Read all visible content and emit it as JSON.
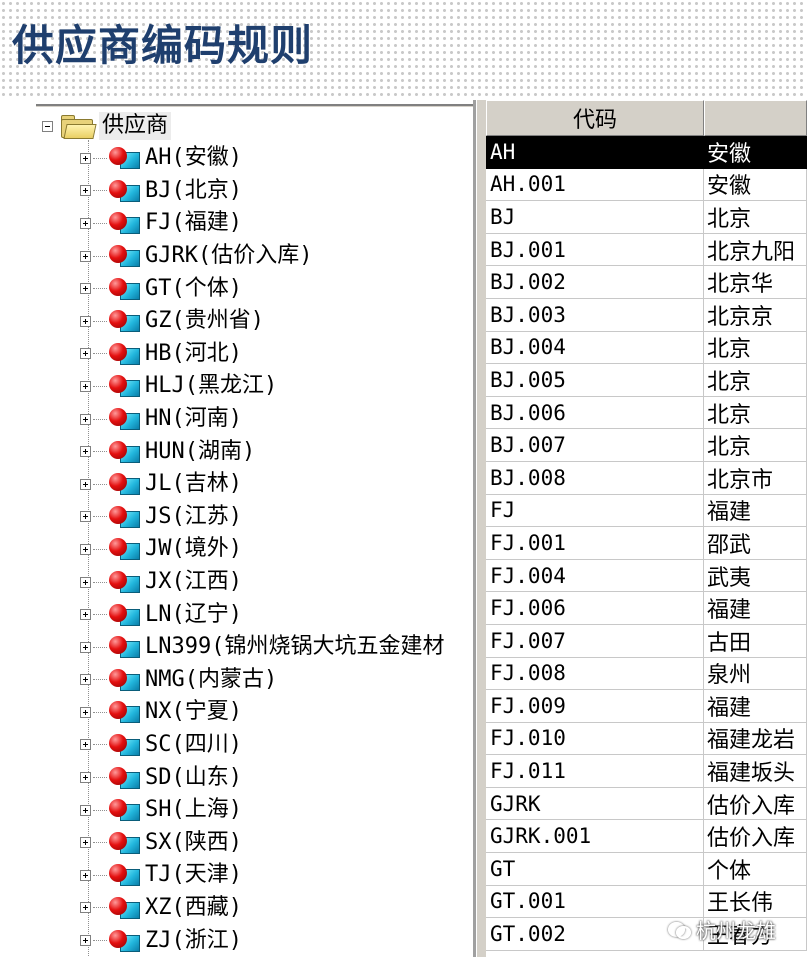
{
  "banner": {
    "title": "供应商编码规则"
  },
  "tree": {
    "root_label": "供应商",
    "items": [
      {
        "label": "AH(安徽)"
      },
      {
        "label": "BJ(北京)"
      },
      {
        "label": "FJ(福建)"
      },
      {
        "label": "GJRK(估价入库)"
      },
      {
        "label": "GT(个体)"
      },
      {
        "label": "GZ(贵州省)"
      },
      {
        "label": "HB(河北)"
      },
      {
        "label": "HLJ(黑龙江)"
      },
      {
        "label": "HN(河南)"
      },
      {
        "label": "HUN(湖南)"
      },
      {
        "label": "JL(吉林)"
      },
      {
        "label": "JS(江苏)"
      },
      {
        "label": "JW(境外)"
      },
      {
        "label": "JX(江西)"
      },
      {
        "label": "LN(辽宁)"
      },
      {
        "label": "LN399(锦州烧锅大坑五金建材"
      },
      {
        "label": "NMG(内蒙古)"
      },
      {
        "label": "NX(宁夏)"
      },
      {
        "label": "SC(四川)"
      },
      {
        "label": "SD(山东)"
      },
      {
        "label": "SH(上海)"
      },
      {
        "label": "SX(陕西)"
      },
      {
        "label": "TJ(天津)"
      },
      {
        "label": "XZ(西藏)"
      },
      {
        "label": "ZJ(浙江)"
      }
    ]
  },
  "grid": {
    "columns": [
      {
        "label": "代码"
      },
      {
        "label": ""
      }
    ],
    "rows": [
      {
        "code": "AH",
        "name": "安徽",
        "selected": true
      },
      {
        "code": "AH.001",
        "name": "安徽"
      },
      {
        "code": "BJ",
        "name": "北京"
      },
      {
        "code": "BJ.001",
        "name": "北京九阳"
      },
      {
        "code": "BJ.002",
        "name": "北京华"
      },
      {
        "code": "BJ.003",
        "name": "北京京"
      },
      {
        "code": "BJ.004",
        "name": "北京"
      },
      {
        "code": "BJ.005",
        "name": "北京"
      },
      {
        "code": "BJ.006",
        "name": "北京"
      },
      {
        "code": "BJ.007",
        "name": "北京"
      },
      {
        "code": "BJ.008",
        "name": "北京市"
      },
      {
        "code": "FJ",
        "name": "福建"
      },
      {
        "code": "FJ.001",
        "name": "邵武"
      },
      {
        "code": "FJ.004",
        "name": "武夷"
      },
      {
        "code": "FJ.006",
        "name": "福建"
      },
      {
        "code": "FJ.007",
        "name": "古田"
      },
      {
        "code": "FJ.008",
        "name": "泉州"
      },
      {
        "code": "FJ.009",
        "name": "福建"
      },
      {
        "code": "FJ.010",
        "name": "福建龙岩"
      },
      {
        "code": "FJ.011",
        "name": "福建坂头"
      },
      {
        "code": "GJRK",
        "name": "估价入库"
      },
      {
        "code": "GJRK.001",
        "name": "估价入库"
      },
      {
        "code": "GT",
        "name": "个体"
      },
      {
        "code": "GT.001",
        "name": "王长伟"
      },
      {
        "code": "GT.002",
        "name": "王春方"
      }
    ]
  },
  "watermark": {
    "text": "杭州龙雄"
  }
}
